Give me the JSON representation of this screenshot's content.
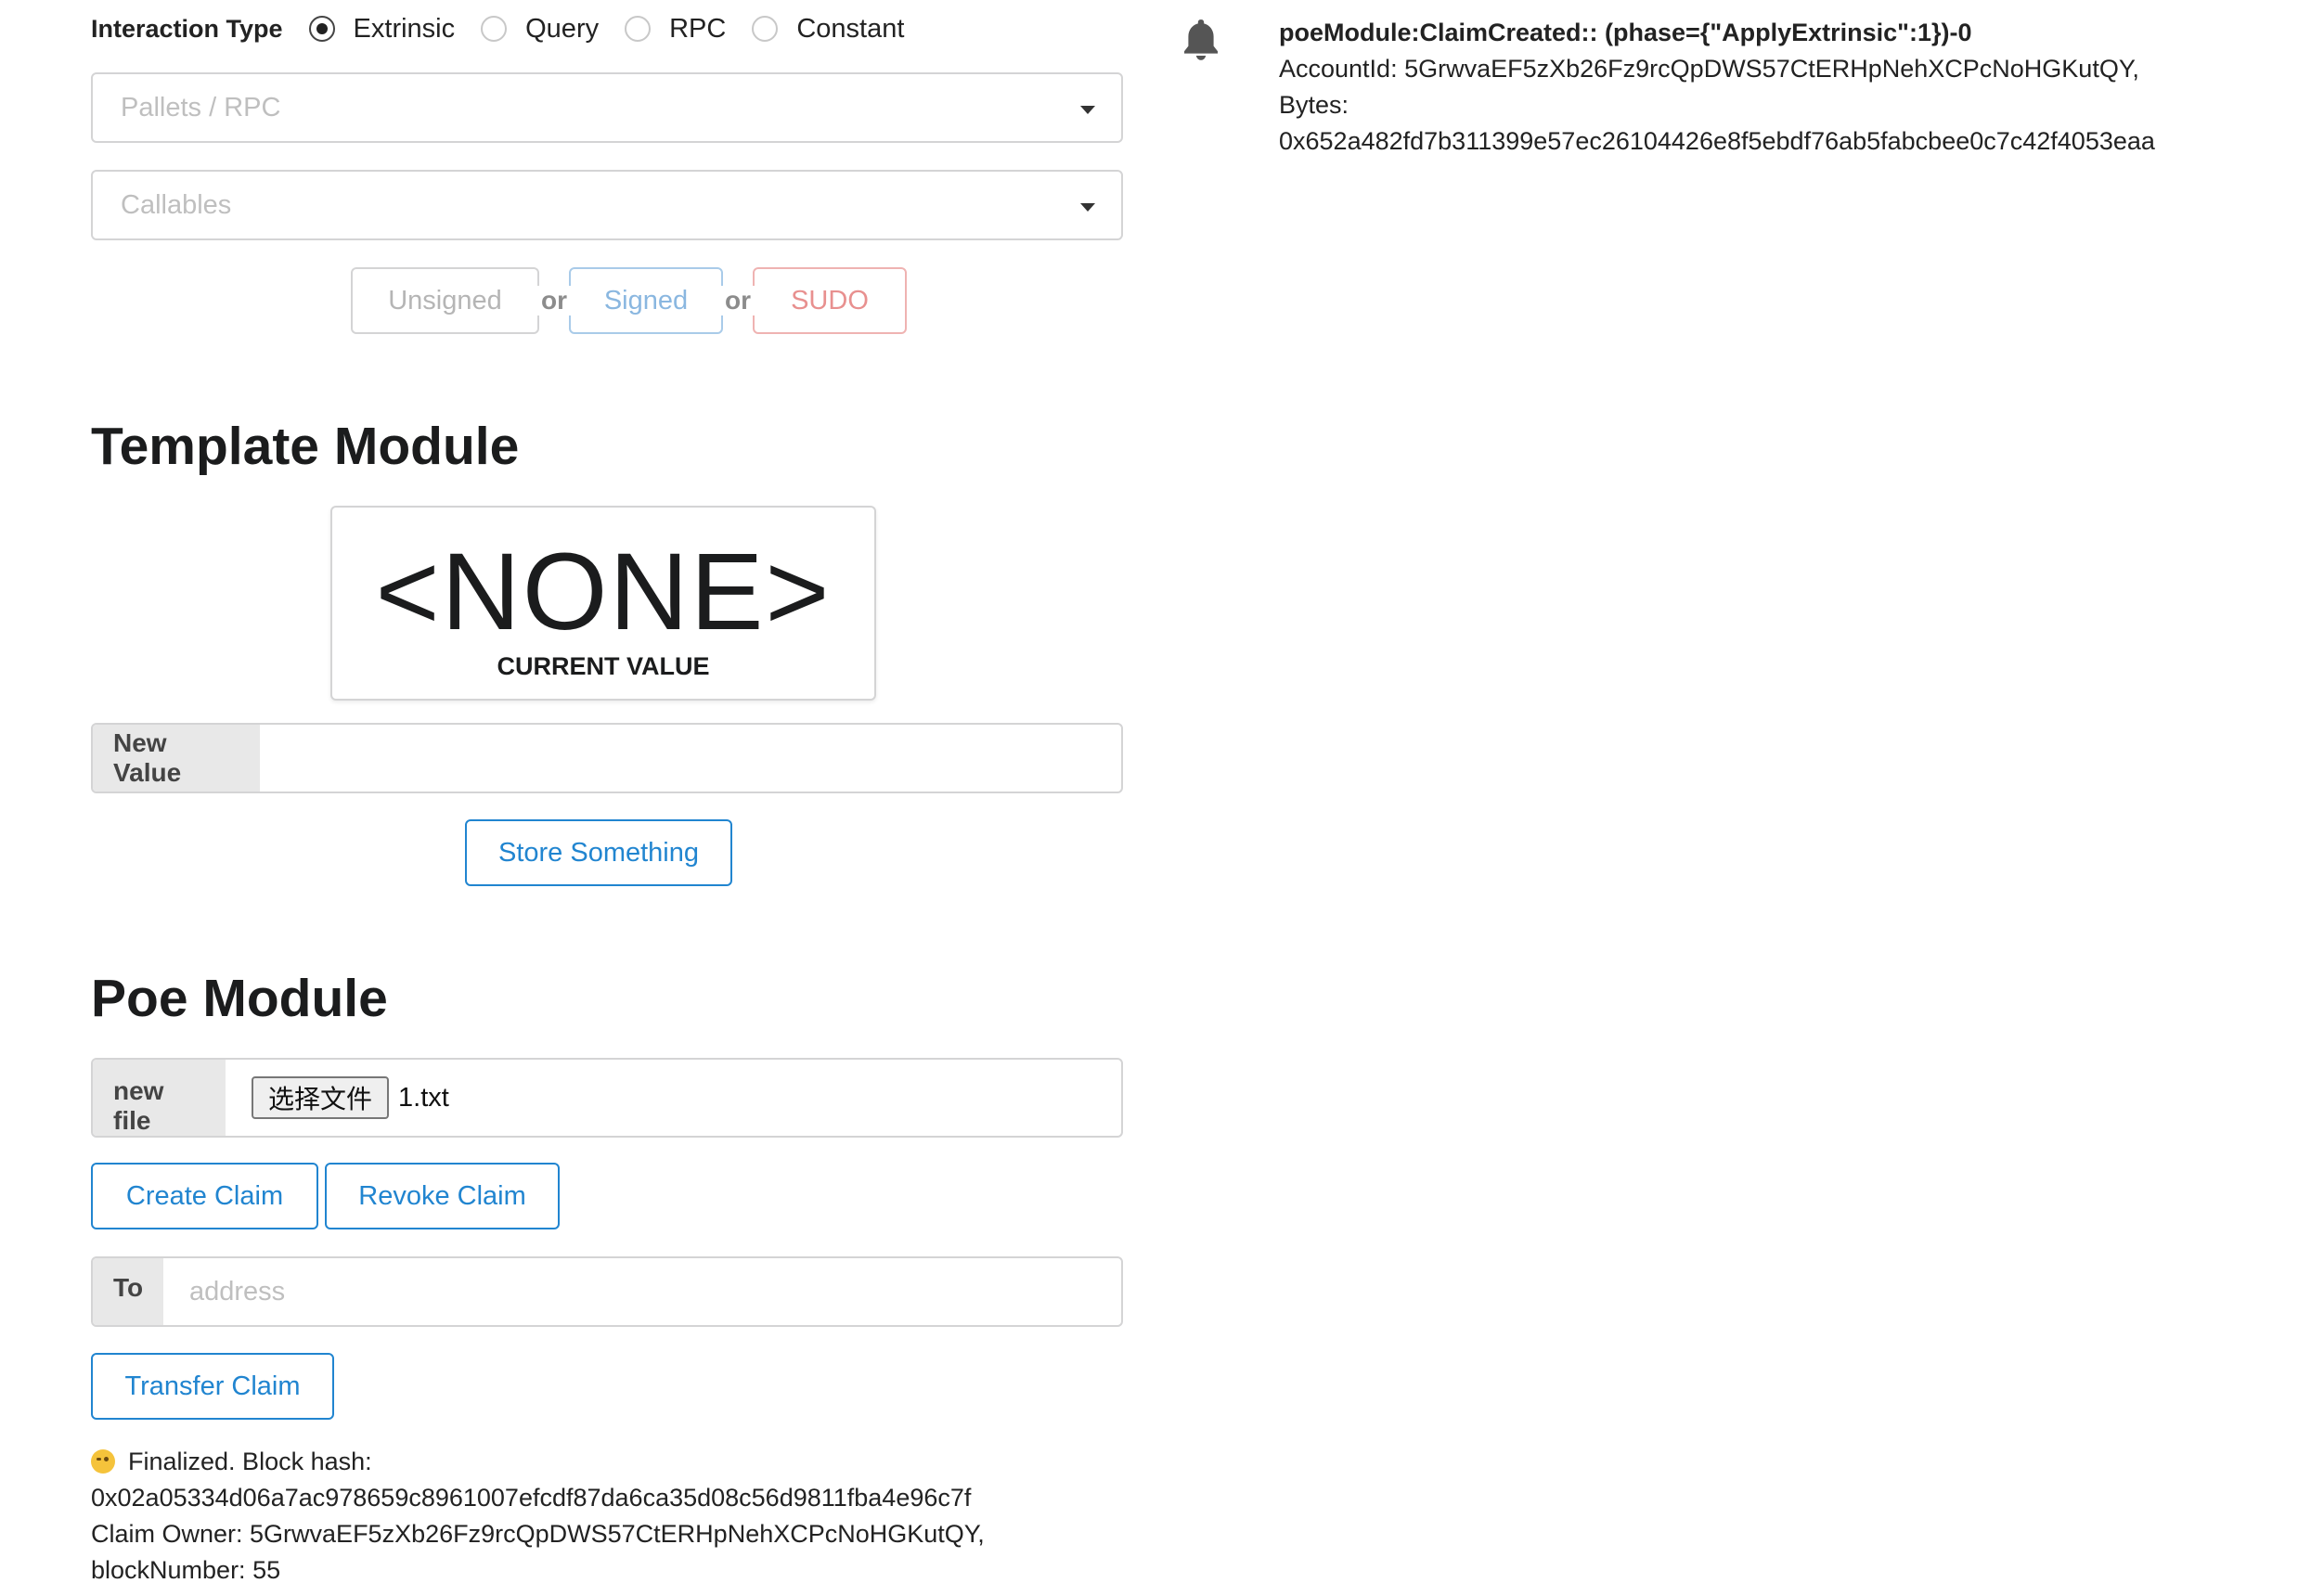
{
  "interaction": {
    "label": "Interaction Type",
    "options": [
      "Extrinsic",
      "Query",
      "RPC",
      "Constant"
    ],
    "selected": "Extrinsic"
  },
  "pallets_placeholder": "Pallets / RPC",
  "callables_placeholder": "Callables",
  "sign": {
    "unsigned": "Unsigned",
    "signed": "Signed",
    "sudo": "SUDO",
    "or": "or"
  },
  "template_module": {
    "title": "Template Module",
    "value": "<NONE>",
    "value_label": "CURRENT VALUE",
    "new_value_label": "New Value",
    "new_value": "",
    "store_button": "Store Something"
  },
  "poe_module": {
    "title": "Poe Module",
    "file_label": "new file",
    "file_button": "选择文件",
    "file_name": "1.txt",
    "create_button": "Create Claim",
    "revoke_button": "Revoke Claim",
    "to_label": "To",
    "to_placeholder": "address",
    "transfer_button": "Transfer Claim"
  },
  "status": {
    "line1": "Finalized. Block hash:",
    "line2": "0x02a05334d06a7ac978659c8961007efcdf87da6ca35d08c56d9811fba4e96c7f",
    "line3": "Claim Owner: 5GrwvaEF5zXb26Fz9rcQpDWS57CtERHpNehXCPcNoHGKutQY,",
    "line4": "blockNumber: 55"
  },
  "event": {
    "icon": "bell-icon",
    "title": "poeModule:ClaimCreated:: (phase={\"ApplyExtrinsic\":1})-0",
    "line1": "AccountId: 5GrwvaEF5zXb26Fz9rcQpDWS57CtERHpNehXCPcNoHGKutQY,",
    "line2": "Bytes:",
    "line3": "0x652a482fd7b311399e57ec26104426e8f5ebdf76ab5fabcbee0c7c42f4053eaa"
  },
  "colors": {
    "primary_blue": "#2185d0",
    "signed_blue": "#8ab7e0",
    "sudo_red": "#e8908f"
  }
}
